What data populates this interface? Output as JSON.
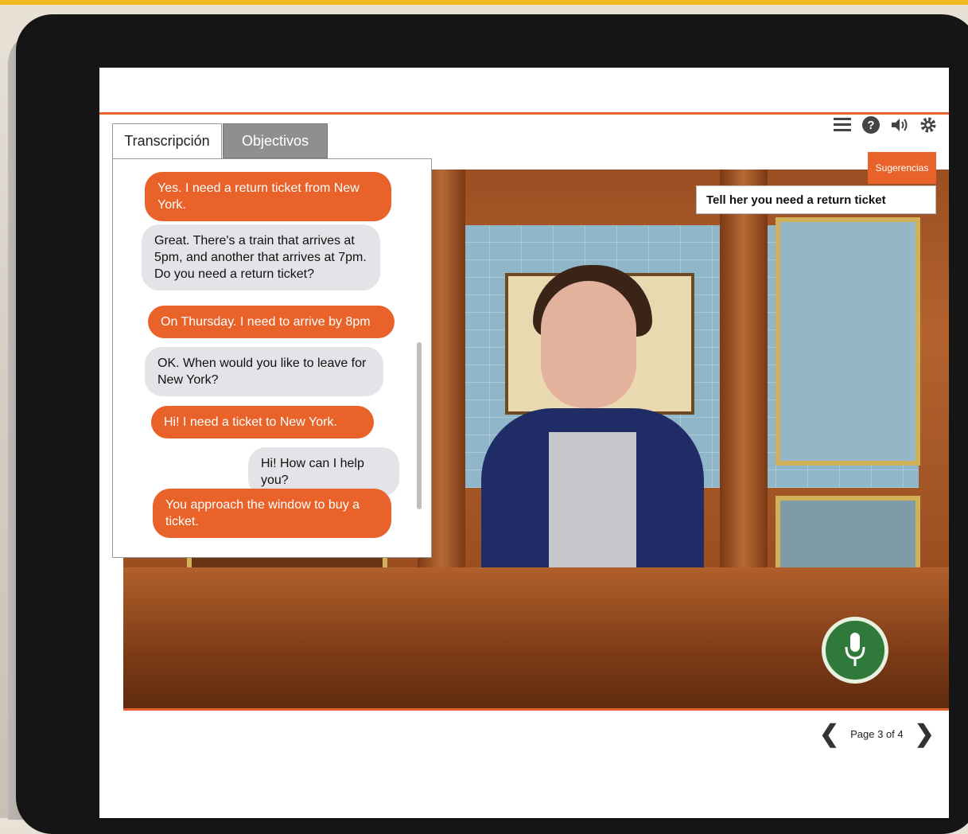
{
  "tabs": {
    "transcript": "Transcripción",
    "objectives": "Objectivos"
  },
  "toolbar": {
    "icons": [
      "menu-icon",
      "help-icon",
      "volume-icon",
      "settings-icon"
    ]
  },
  "hints": {
    "button_label": "Sugerencias",
    "text": "Tell her you need a return ticket"
  },
  "transcript": {
    "messages": [
      {
        "speaker": "user",
        "text": "Yes. I need a return ticket from New York."
      },
      {
        "speaker": "agent",
        "text": "Great. There's a train that arrives at 5pm, and another that arrives at 7pm. Do you need a return ticket?"
      },
      {
        "speaker": "user",
        "text": "On Thursday. I need to arrive by 8pm"
      },
      {
        "speaker": "agent",
        "text": "OK. When would you like to leave for New York?"
      },
      {
        "speaker": "user",
        "text": "Hi! I need a ticket to New York."
      },
      {
        "speaker": "agent",
        "text": "Hi! How can I help you?"
      },
      {
        "speaker": "user",
        "text": "You approach the window to buy a ticket."
      }
    ]
  },
  "pager": {
    "label": "Page 3 of 4"
  },
  "colors": {
    "accent": "#e8622a",
    "frame_top": "#f3b81d",
    "mic": "#2f7a3a"
  }
}
